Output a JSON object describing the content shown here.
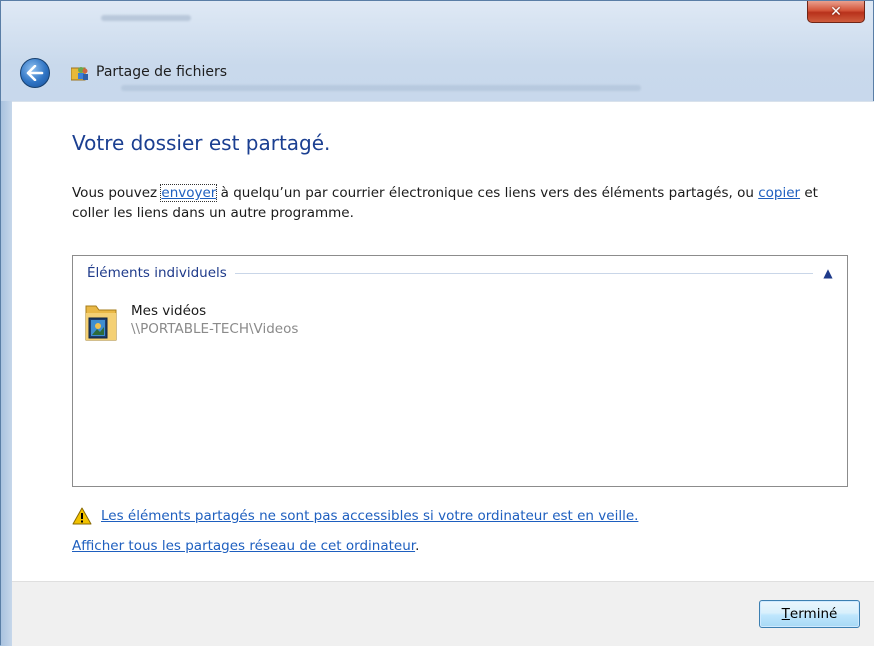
{
  "window": {
    "title": "Partage de fichiers"
  },
  "main": {
    "heading": "Votre dossier est partagé.",
    "description": {
      "before_send": "Vous pouvez ",
      "send_link": "envoyer",
      "middle": " à quelqu’un par courrier électronique ces liens vers des éléments partagés, ou ",
      "copy_link": "copier",
      "after_copy": " et coller les liens dans un autre programme."
    },
    "group": {
      "title": "Éléments individuels",
      "items": [
        {
          "name": "Mes vidéos",
          "path": "\\\\PORTABLE-TECH\\Videos"
        }
      ]
    },
    "warning_link": "Les éléments partagés ne sont pas accessibles si votre ordinateur est en veille.",
    "network_link": "Afficher tous les partages réseau de cet ordinateur",
    "network_suffix": "."
  },
  "footer": {
    "done_accel": "T",
    "done_rest": "erminé"
  },
  "colors": {
    "heading": "#1b3f91",
    "link": "#1e5fbf",
    "warning": "#f2c200"
  },
  "icons": {
    "close": "close-icon",
    "back": "back-arrow-icon",
    "sharing": "sharing-users-icon",
    "collapse": "chevron-up-icon",
    "folder": "video-folder-icon",
    "warning": "warning-icon"
  }
}
